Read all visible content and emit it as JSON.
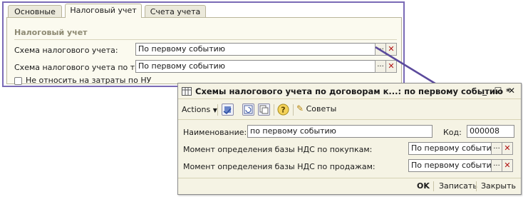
{
  "tax_form": {
    "tabs": [
      "Основные",
      "Налоговый учет",
      "Счета учета"
    ],
    "section_title": "Налоговый учет",
    "scheme_label": "Схема налогового учета:",
    "scheme_value": "По первому событию",
    "tare_label": "Схема налогового учета по таре:",
    "tare_value": "По первому событию",
    "no_expense_label": "Не относить на затраты по НУ",
    "dots": "...",
    "clear": "✕"
  },
  "dialog": {
    "title": "Схемы налогового учета по договорам к...: по первому событию *",
    "actions_label": "Actions",
    "advice_label": "Советы",
    "name_label": "Наименование:",
    "name_value": "по первому событию",
    "code_label": "Код:",
    "code_value": "000008",
    "vat_purchases_label": "Момент определения базы НДС по покупкам:",
    "vat_purchases_value": "По первому событию",
    "vat_sales_label": "Момент определения базы НДС по продажам:",
    "vat_sales_value": "По первому событию",
    "ok_label": "OK",
    "save_label": "Записать",
    "close_label": "Закрыть"
  },
  "colors": {
    "frame_purple": "#7a6ab6",
    "arrow": "#5b4a9c",
    "clear_red": "#b01010"
  }
}
